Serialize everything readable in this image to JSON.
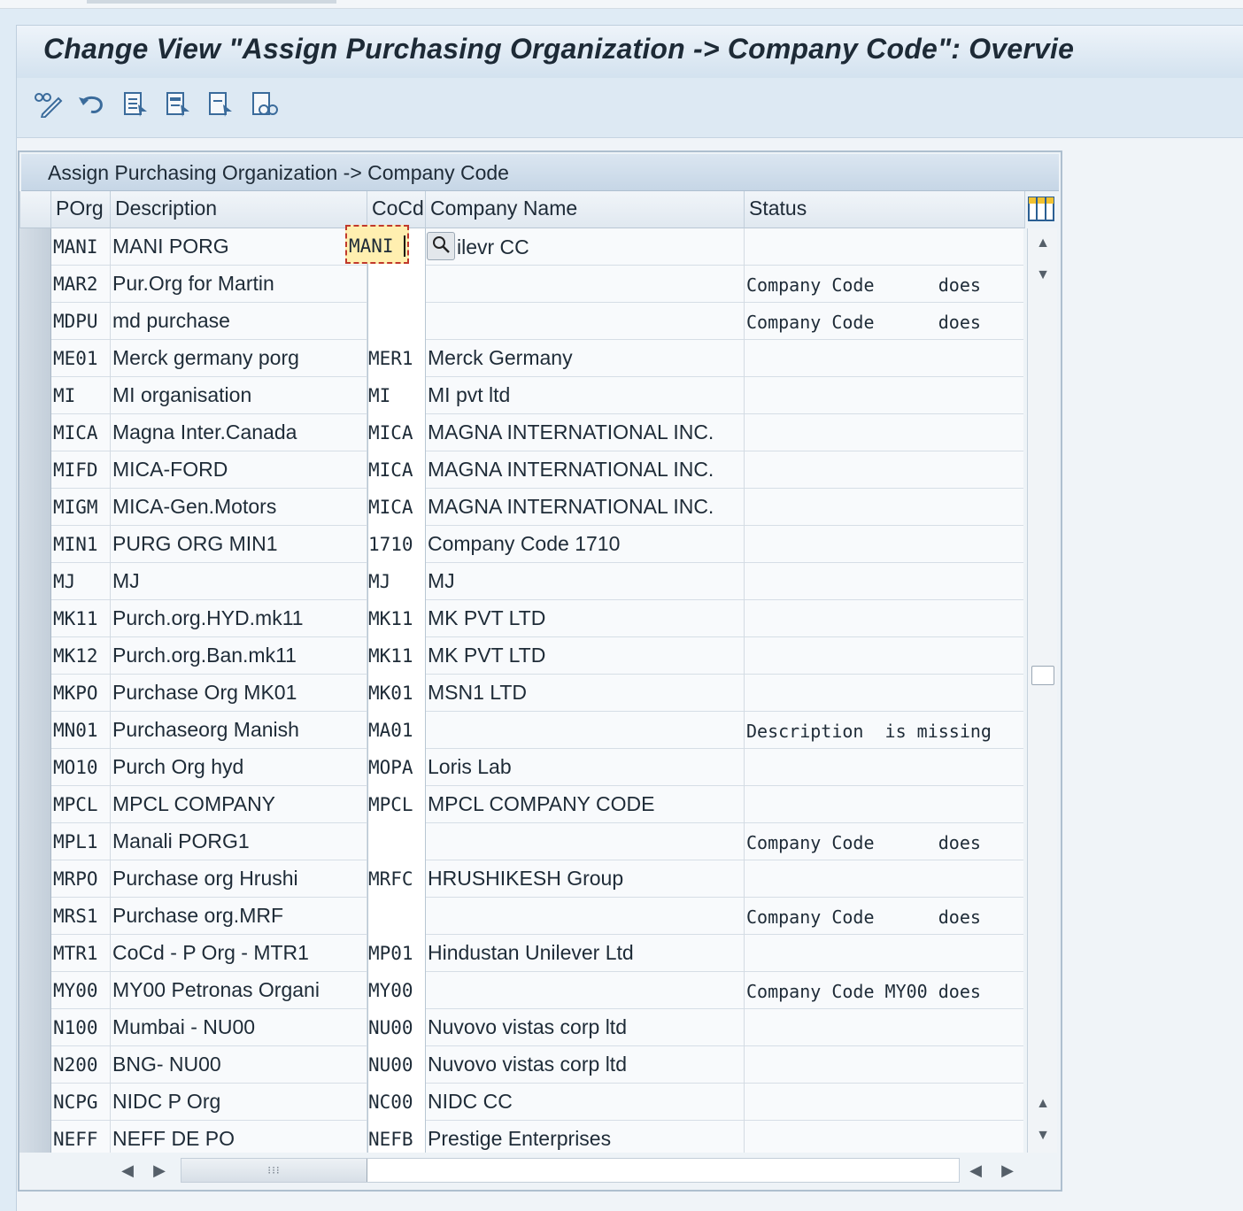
{
  "window": {
    "title": "Change View \"Assign Purchasing  Organization -> Company Code\": Overvie"
  },
  "toolbar": {
    "buttons": [
      {
        "name": "display-change-icon"
      },
      {
        "name": "undo-icon"
      },
      {
        "name": "select-all-icon"
      },
      {
        "name": "select-block-icon"
      },
      {
        "name": "deselect-all-icon"
      },
      {
        "name": "print-preview-icon"
      }
    ]
  },
  "table": {
    "title": "Assign Purchasing  Organization -> Company Code",
    "headers": {
      "porg": "POrg",
      "description": "Description",
      "cocd": "CoCd",
      "company_name": "Company Name",
      "status": "Status"
    },
    "focused_cell": {
      "value": "MANI",
      "company_name_visible": "ilevr CC"
    },
    "rows": [
      {
        "porg": "MANI",
        "description": "MANI PORG",
        "cocd": "",
        "company_name": "",
        "status": ""
      },
      {
        "porg": "MAR2",
        "description": "Pur.Org for Martin",
        "cocd": "",
        "company_name": "",
        "status": "Company Code      does"
      },
      {
        "porg": "MDPU",
        "description": "md purchase",
        "cocd": "",
        "company_name": "",
        "status": "Company Code      does"
      },
      {
        "porg": "ME01",
        "description": "Merck germany porg",
        "cocd": "MER1",
        "company_name": "Merck Germany",
        "status": ""
      },
      {
        "porg": "MI",
        "description": "MI organisation",
        "cocd": "MI",
        "company_name": "MI pvt ltd",
        "status": ""
      },
      {
        "porg": "MICA",
        "description": "Magna Inter.Canada",
        "cocd": "MICA",
        "company_name": "MAGNA INTERNATIONAL INC.",
        "status": ""
      },
      {
        "porg": "MIFD",
        "description": "MICA-FORD",
        "cocd": "MICA",
        "company_name": "MAGNA INTERNATIONAL INC.",
        "status": ""
      },
      {
        "porg": "MIGM",
        "description": "MICA-Gen.Motors",
        "cocd": "MICA",
        "company_name": "MAGNA INTERNATIONAL INC.",
        "status": ""
      },
      {
        "porg": "MIN1",
        "description": "PURG ORG MIN1",
        "cocd": "1710",
        "company_name": "Company Code 1710",
        "status": ""
      },
      {
        "porg": "MJ",
        "description": "MJ",
        "cocd": "MJ",
        "company_name": "MJ",
        "status": ""
      },
      {
        "porg": "MK11",
        "description": "Purch.org.HYD.mk11",
        "cocd": "MK11",
        "company_name": "MK PVT LTD",
        "status": ""
      },
      {
        "porg": "MK12",
        "description": "Purch.org.Ban.mk11",
        "cocd": "MK11",
        "company_name": "MK PVT LTD",
        "status": ""
      },
      {
        "porg": "MKPO",
        "description": "Purchase Org MK01",
        "cocd": "MK01",
        "company_name": "MSN1 LTD",
        "status": ""
      },
      {
        "porg": "MN01",
        "description": "Purchaseorg Manish",
        "cocd": "MA01",
        "company_name": "",
        "status": "Description  is missing"
      },
      {
        "porg": "MO10",
        "description": "Purch Org hyd",
        "cocd": "MOPA",
        "company_name": "Loris Lab",
        "status": ""
      },
      {
        "porg": "MPCL",
        "description": "MPCL COMPANY",
        "cocd": "MPCL",
        "company_name": "MPCL COMPANY CODE",
        "status": ""
      },
      {
        "porg": "MPL1",
        "description": "Manali PORG1",
        "cocd": "",
        "company_name": "",
        "status": "Company Code      does"
      },
      {
        "porg": "MRPO",
        "description": "Purchase org Hrushi",
        "cocd": "MRFC",
        "company_name": "HRUSHIKESH Group",
        "status": ""
      },
      {
        "porg": "MRS1",
        "description": "Purchase org.MRF",
        "cocd": "",
        "company_name": "",
        "status": "Company Code      does"
      },
      {
        "porg": "MTR1",
        "description": "CoCd - P Org - MTR1",
        "cocd": "MP01",
        "company_name": "Hindustan Unilever Ltd",
        "status": ""
      },
      {
        "porg": "MY00",
        "description": "MY00 Petronas Organi",
        "cocd": "MY00",
        "company_name": "",
        "status": "Company Code MY00 does"
      },
      {
        "porg": "N100",
        "description": "Mumbai - NU00",
        "cocd": "NU00",
        "company_name": "Nuvovo vistas corp ltd",
        "status": ""
      },
      {
        "porg": "N200",
        "description": "BNG- NU00",
        "cocd": "NU00",
        "company_name": "Nuvovo vistas corp ltd",
        "status": ""
      },
      {
        "porg": "NCPG",
        "description": "NIDC P Org",
        "cocd": "NC00",
        "company_name": "NIDC CC",
        "status": ""
      },
      {
        "porg": "NEFF",
        "description": "NEFF DE PO",
        "cocd": "NEFB",
        "company_name": "Prestige Enterprises",
        "status": ""
      }
    ]
  },
  "icons": {
    "column_config": "column-settings-icon",
    "search_help": "magnifier-icon",
    "scroll_up": "chevron-up-icon",
    "scroll_down": "chevron-down-icon",
    "scroll_left": "chevron-left-icon",
    "scroll_right": "chevron-right-icon"
  },
  "colors": {
    "background": "#dfebf5",
    "focus_field": "#ffefb0",
    "focus_border": "#c0392b"
  }
}
